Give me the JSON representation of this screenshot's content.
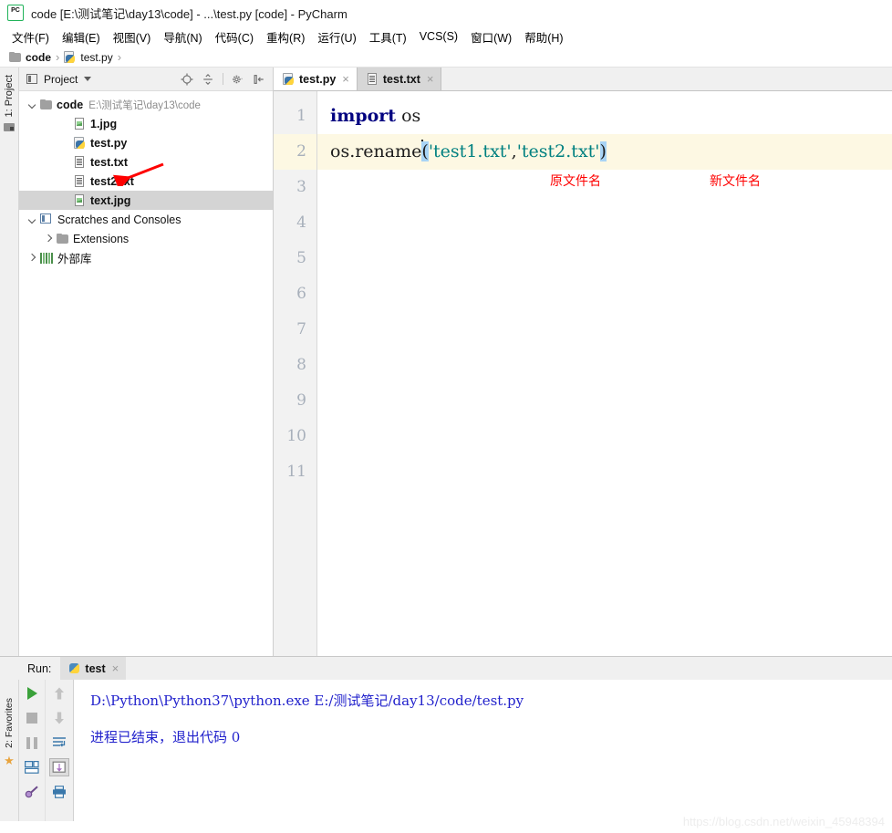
{
  "window": {
    "title": "code [E:\\测试笔记\\day13\\code] - ...\\test.py [code] - PyCharm",
    "app_icon": "pycharm-logo-icon"
  },
  "menubar": {
    "items": [
      {
        "label": "文件(F)",
        "name": "menu-file"
      },
      {
        "label": "编辑(E)",
        "name": "menu-edit"
      },
      {
        "label": "视图(V)",
        "name": "menu-view"
      },
      {
        "label": "导航(N)",
        "name": "menu-navigate"
      },
      {
        "label": "代码(C)",
        "name": "menu-code"
      },
      {
        "label": "重构(R)",
        "name": "menu-refactor"
      },
      {
        "label": "运行(U)",
        "name": "menu-run"
      },
      {
        "label": "工具(T)",
        "name": "menu-tools"
      },
      {
        "label": "VCS(S)",
        "name": "menu-vcs"
      },
      {
        "label": "窗口(W)",
        "name": "menu-window"
      },
      {
        "label": "帮助(H)",
        "name": "menu-help"
      }
    ]
  },
  "breadcrumb": {
    "items": [
      {
        "label": "code",
        "icon": "folder-icon"
      },
      {
        "label": "test.py",
        "icon": "python-file-icon"
      }
    ],
    "separator": "›"
  },
  "left_strip": {
    "project_tab_label": "1: Project"
  },
  "project_panel": {
    "title": "Project",
    "toolbar": [
      {
        "name": "locate-target-icon",
        "title": "Select Opened File"
      },
      {
        "name": "collapse-all-icon",
        "title": "Collapse All"
      },
      {
        "name": "settings-gear-icon",
        "title": "Settings"
      },
      {
        "name": "hide-panel-icon",
        "title": "Hide"
      }
    ],
    "tree": [
      {
        "label": "code",
        "path": "E:\\测试笔记\\day13\\code",
        "icon": "folder-icon",
        "twisty": "down",
        "indent": 0,
        "bold": true,
        "selected": false
      },
      {
        "label": "1.jpg",
        "path": "",
        "icon": "image-file-icon",
        "twisty": "none",
        "indent": 1,
        "bold": true,
        "selected": false
      },
      {
        "label": "test.py",
        "path": "",
        "icon": "python-file-icon",
        "twisty": "none",
        "indent": 1,
        "bold": true,
        "selected": false
      },
      {
        "label": "test.txt",
        "path": "",
        "icon": "text-file-icon",
        "twisty": "none",
        "indent": 1,
        "bold": true,
        "selected": false
      },
      {
        "label": "test2.txt",
        "path": "",
        "icon": "text-file-icon",
        "twisty": "none",
        "indent": 1,
        "bold": true,
        "selected": false
      },
      {
        "label": "text.jpg",
        "path": "",
        "icon": "image-file-icon",
        "twisty": "none",
        "indent": 1,
        "bold": true,
        "selected": true
      },
      {
        "label": "Scratches and Consoles",
        "path": "",
        "icon": "scratches-icon",
        "twisty": "down",
        "indent": 0,
        "bold": false,
        "selected": false
      },
      {
        "label": "Extensions",
        "path": "",
        "icon": "folder-icon",
        "twisty": "right",
        "indent": 1,
        "bold": false,
        "selected": false
      },
      {
        "label": "外部库",
        "path": "",
        "icon": "library-icon",
        "twisty": "right",
        "indent": 0,
        "bold": false,
        "selected": false
      }
    ],
    "annotation_arrow": {
      "name": "red-arrow-pointing-to-test2-txt",
      "color": "#fe0000"
    }
  },
  "editor": {
    "tabs": [
      {
        "label": "test.py",
        "icon": "python-file-icon",
        "active": true,
        "close": "×"
      },
      {
        "label": "test.txt",
        "icon": "text-file-icon",
        "active": false,
        "close": "×"
      }
    ],
    "line_numbers": [
      "1",
      "2",
      "3",
      "4",
      "5",
      "6",
      "7",
      "8",
      "9",
      "10",
      "11"
    ],
    "highlighted_line": 2,
    "code": {
      "line1": {
        "keyword": "import",
        "rest": " os"
      },
      "line2": {
        "call": "os.rename",
        "open_paren": "(",
        "arg1": "'test1.txt'",
        "comma": ",",
        "arg2": "'test2.txt'",
        "close_paren": ")"
      }
    },
    "annotations": [
      {
        "text": "原文件名",
        "name": "annotation-original-filename"
      },
      {
        "text": "新文件名",
        "name": "annotation-new-filename"
      }
    ],
    "colors": {
      "keyword": "#000080",
      "string": "#008080",
      "bracket_match": "#a8d4f5",
      "current_line": "#fdf8e3",
      "annotation_red": "#fe0000"
    }
  },
  "run_panel": {
    "label": "Run:",
    "tab": {
      "label": "test",
      "icon": "python-file-icon",
      "close": "×"
    },
    "toolbar_left": [
      {
        "name": "rerun-play-icon"
      },
      {
        "name": "stop-icon"
      },
      {
        "name": "pause-icon"
      },
      {
        "name": "console-view-icon"
      },
      {
        "name": "attach-debugger-icon"
      }
    ],
    "toolbar_right": [
      {
        "name": "up-arrow-icon"
      },
      {
        "name": "down-arrow-icon"
      },
      {
        "name": "soft-wrap-icon"
      },
      {
        "name": "scroll-to-end-icon",
        "pressed": true
      },
      {
        "name": "print-icon"
      }
    ],
    "output": [
      "D:\\Python\\Python37\\python.exe E:/测试笔记/day13/code/test.py",
      "进程已结束，退出代码 0"
    ],
    "favorites_tab_label": "2: Favorites"
  },
  "watermark": {
    "text": "https://blog.csdn.net/weixin_45948394"
  }
}
